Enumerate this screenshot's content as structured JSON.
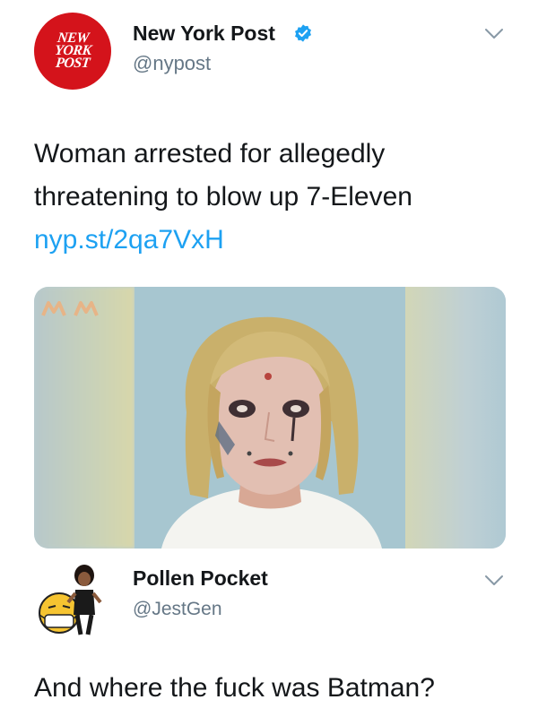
{
  "tweet": {
    "logo_lines": [
      "NEW",
      "YORK",
      "POST"
    ],
    "author_name": "New York Post",
    "handle": "@nypost",
    "text": "Woman arrested for allegedly threatening to blow up 7-Eleven",
    "link": "nyp.st/2qa7VxH",
    "colors": {
      "brand": "#d4131b",
      "link": "#1da1f2",
      "verified": "#1da1f2",
      "muted": "#657786"
    },
    "icons": [
      "verified-icon",
      "chevron-down-icon"
    ]
  },
  "reply": {
    "author_name": "Pollen Pocket",
    "handle": "@JestGen",
    "text": "And where the fuck was Batman?",
    "icons": [
      "avatar-bitmoji",
      "chevron-down-icon"
    ]
  }
}
